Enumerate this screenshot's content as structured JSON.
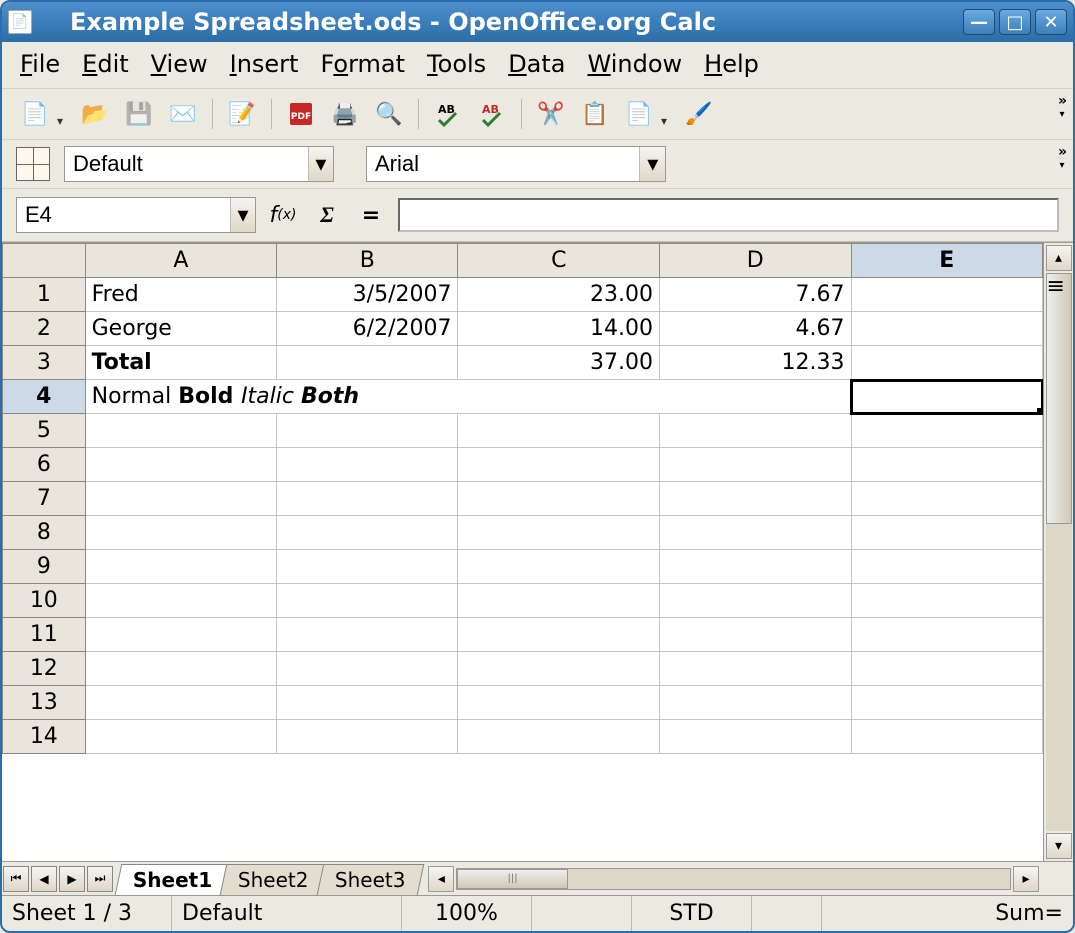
{
  "window": {
    "title": "Example Spreadsheet.ods - OpenOffice.org Calc"
  },
  "menu": {
    "file": "File",
    "edit": "Edit",
    "view": "View",
    "insert": "Insert",
    "format": "Format",
    "tools": "Tools",
    "data": "Data",
    "window": "Window",
    "help": "Help"
  },
  "format_toolbar": {
    "style_name": "Default",
    "font_name": "Arial"
  },
  "formula": {
    "cell_ref": "E4",
    "value": ""
  },
  "columns": [
    "A",
    "B",
    "C",
    "D",
    "E"
  ],
  "selected_column_index": 4,
  "row_count": 14,
  "selected_row": 4,
  "active_cell": {
    "row": 4,
    "col": 4
  },
  "cells": {
    "1": {
      "A": "Fred",
      "B": "3/5/2007",
      "C": "23.00",
      "D": "7.67"
    },
    "2": {
      "A": "George",
      "B": "6/2/2007",
      "C": "14.00",
      "D": "4.67"
    },
    "3": {
      "A": "Total",
      "B": "",
      "C": "37.00",
      "D": "12.33"
    },
    "4_rich": {
      "normal": "Normal ",
      "bold": "Bold ",
      "italic": "Italic ",
      "both": "Both"
    }
  },
  "sheet_tabs": [
    "Sheet1",
    "Sheet2",
    "Sheet3"
  ],
  "active_sheet": 0,
  "status": {
    "sheet_pos": "Sheet 1 / 3",
    "page_style": "Default",
    "zoom": "100%",
    "mode": "STD",
    "sum": "Sum="
  }
}
